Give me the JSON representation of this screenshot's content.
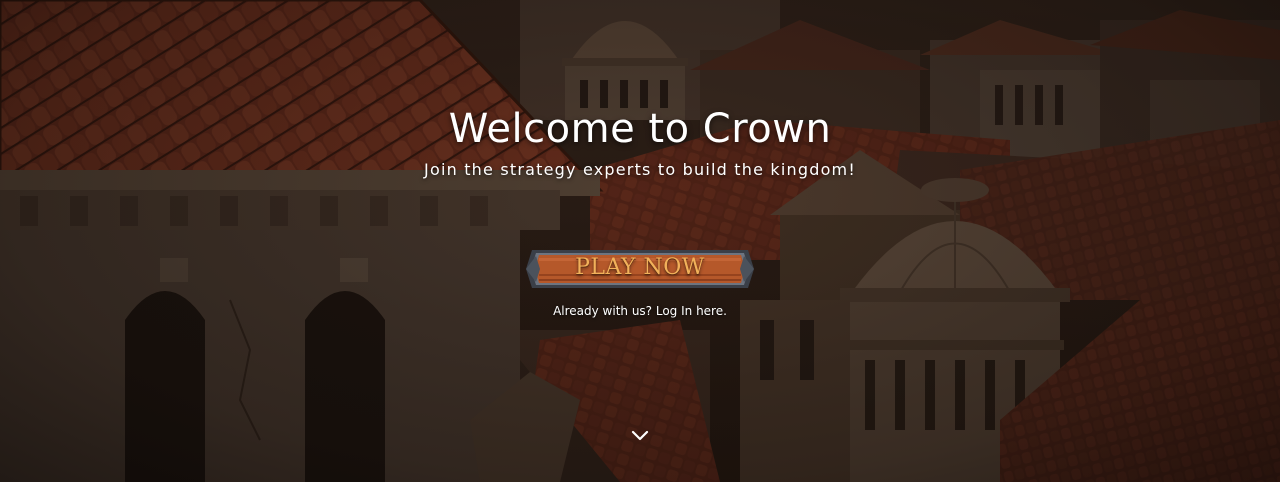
{
  "hero": {
    "title": "Welcome to Crown",
    "subtitle": "Join the strategy experts to build the kingdom!",
    "play_button_label": "PLAY NOW",
    "login_link": "Already with us? Log In here.",
    "scroll_icon": "chevron-down-icon"
  },
  "colors": {
    "button_text": "#f2b15a",
    "button_wood": "#b5582a",
    "text": "#ffffff",
    "roof": "#8a3a22"
  }
}
